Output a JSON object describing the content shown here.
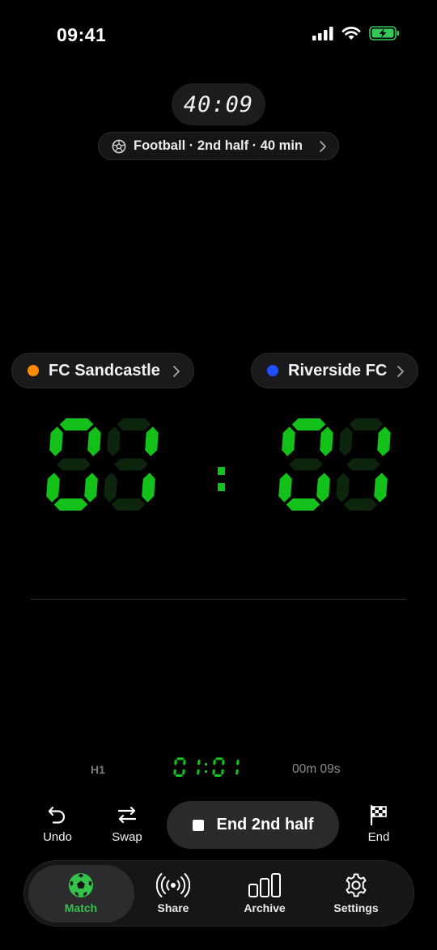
{
  "status_bar": {
    "time": "09:41"
  },
  "game_clock": {
    "time": "40:09"
  },
  "match_info": {
    "label": "Football · 2nd half · 40 min",
    "icon": "soccer-ball-icon"
  },
  "teams": {
    "home": {
      "name": "FC Sandcastle",
      "color": "#ff8a00"
    },
    "away": {
      "name": "Riverside FC",
      "color": "#1f4fff"
    }
  },
  "score": {
    "home": 1,
    "away": 1,
    "separator": ":",
    "segment_on_color": "#13c11a",
    "segment_off_color": "#0d240d"
  },
  "period": {
    "label": "H1",
    "score": "01:01",
    "elapsed": "00m 09s"
  },
  "actions": {
    "undo": "Undo",
    "swap": "Swap",
    "end_half": "End 2nd half",
    "end": "End"
  },
  "tabs": [
    {
      "label": "Match",
      "icon": "soccer-ball-icon",
      "active": true
    },
    {
      "label": "Share",
      "icon": "broadcast-icon",
      "active": false
    },
    {
      "label": "Archive",
      "icon": "bar-chart-icon",
      "active": false
    },
    {
      "label": "Settings",
      "icon": "gear-icon",
      "active": false
    }
  ],
  "accent_color": "#34c24a"
}
